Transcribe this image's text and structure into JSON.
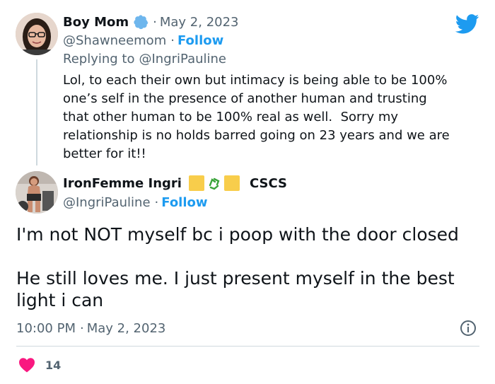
{
  "reply_tweet": {
    "display_name": "Boy Mom",
    "verified_icon": "verified-badge-icon",
    "date": "May 2, 2023",
    "separator": "·",
    "handle": "@Shawneemom",
    "follow_label": "Follow",
    "replying_label": "Replying to",
    "replying_handle": "@IngriPauline",
    "text": "Lol, to each their own but intimacy is being able to be 100%\none’s self in the presence of another human and trusting\nthat other human to be 100% real as well.  Sorry my\nrelationship is no holds barred going on 23 years and we are\nbetter for it!!"
  },
  "main_tweet": {
    "display_name": "IronFemme Ingri",
    "name_suffix": "CSCS",
    "handle": "@IngriPauline",
    "separator": "·",
    "follow_label": "Follow",
    "text": "I'm not NOT myself bc i poop with the door closed\n\nHe still loves me. I just present myself in the best\nlight i can",
    "time": "10:00 PM",
    "date": "May 2, 2023",
    "like_count": "14"
  },
  "icons": {
    "brand": "twitter-bird-icon",
    "info": "info-icon",
    "like": "heart-icon"
  },
  "colors": {
    "accent": "#1d9bf0",
    "like": "#f91880",
    "verified": "#6eb6ed",
    "muted": "#536471",
    "emoji_yellow": "#f8cd4b",
    "emoji_green": "#3aa43a"
  }
}
